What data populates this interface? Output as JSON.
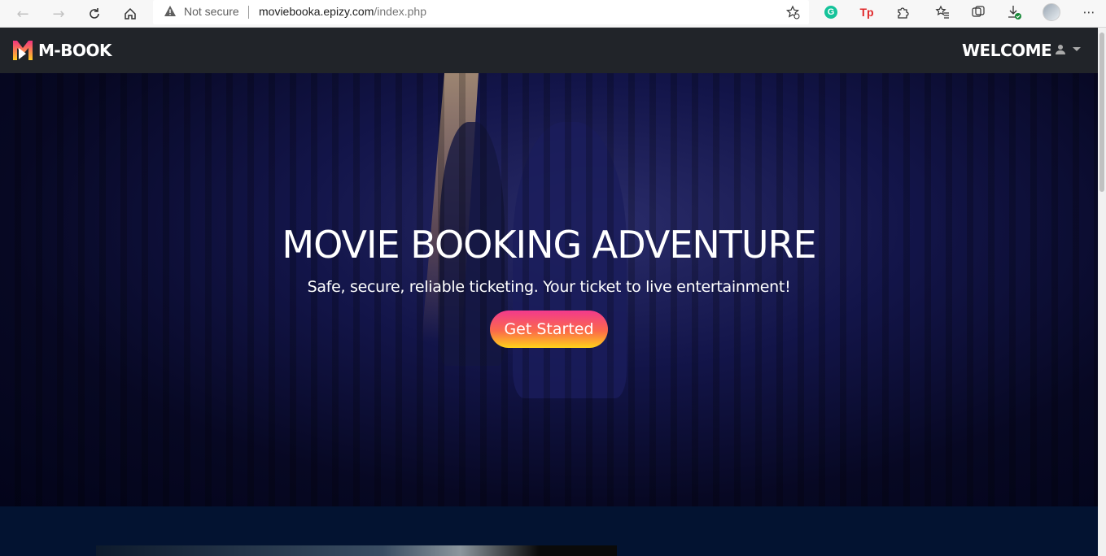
{
  "browser": {
    "security_label": "Not secure",
    "url_host": "moviebooka.epizy.com",
    "url_path": "/index.php",
    "extensions": [
      "grammarly-icon",
      "tp-extension-icon",
      "puzzle-icon"
    ],
    "tp_label": "Tp",
    "grammarly_label": "G"
  },
  "navbar": {
    "brand": "M-BOOK",
    "welcome": "WELCOME"
  },
  "hero": {
    "title": "MOVIE BOOKING ADVENTURE",
    "subtitle": "Safe, secure, reliable ticketing. Your ticket to live entertainment!",
    "cta_label": "Get Started"
  },
  "colors": {
    "navbar_bg": "#212429",
    "hero_bg": "#050624",
    "cta_gradient_top": "#f23a8c",
    "cta_gradient_bottom": "#ffd21a",
    "section_bg": "#031331"
  }
}
